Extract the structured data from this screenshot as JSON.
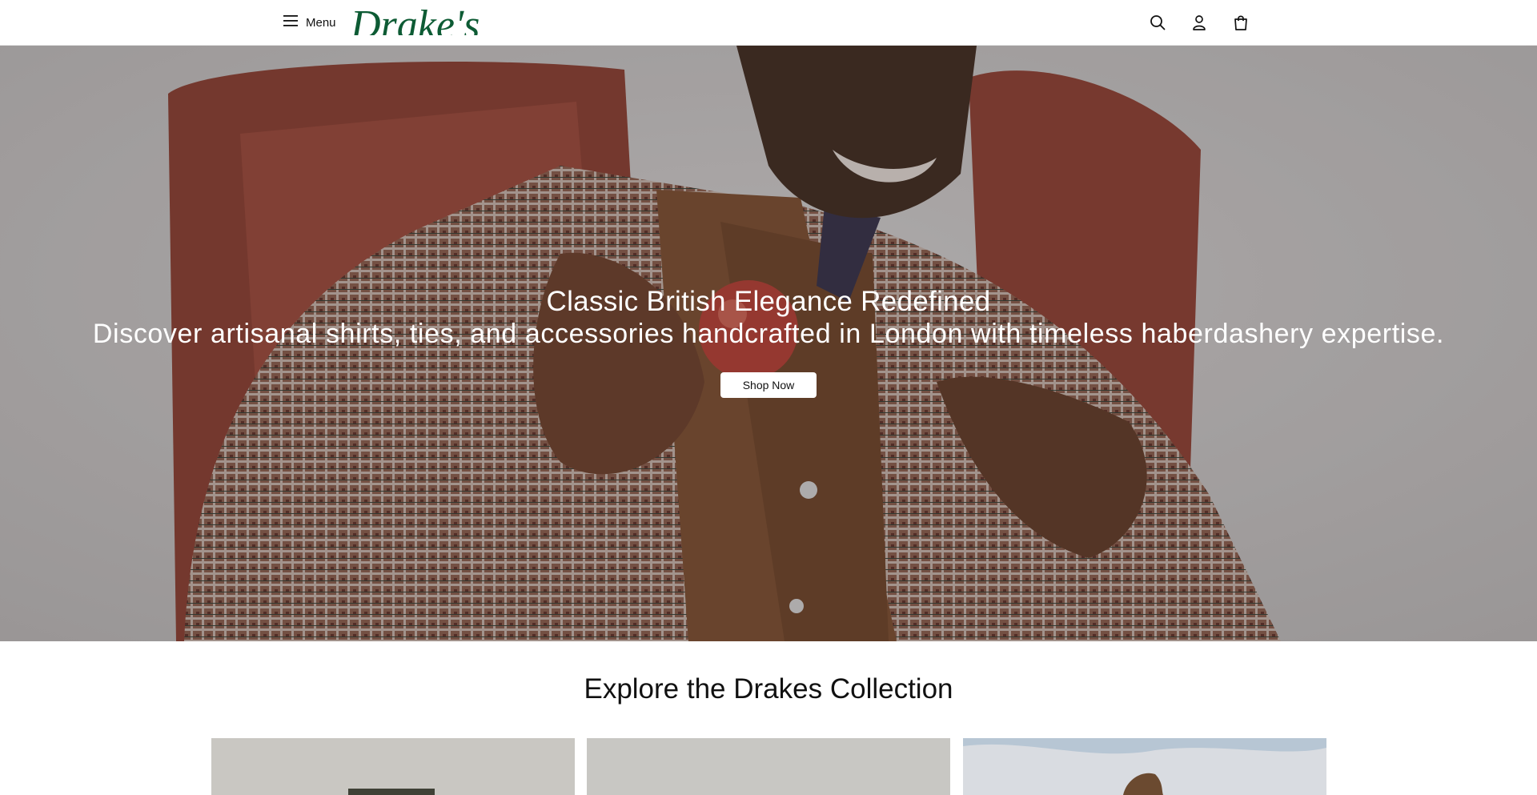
{
  "header": {
    "menu_label": "Menu",
    "logo_text": "Drake's",
    "brand_color": "#0d5b34",
    "icons": [
      "hamburger-icon",
      "search-icon",
      "account-icon",
      "bag-icon"
    ]
  },
  "hero": {
    "title": "Classic British Elegance Redefined",
    "subtitle": "Discover artisanal shirts, ties, and accessories handcrafted in London with timeless haberdashery expertise.",
    "cta_label": "Shop Now"
  },
  "collection": {
    "title": "Explore the Drakes Collection"
  }
}
